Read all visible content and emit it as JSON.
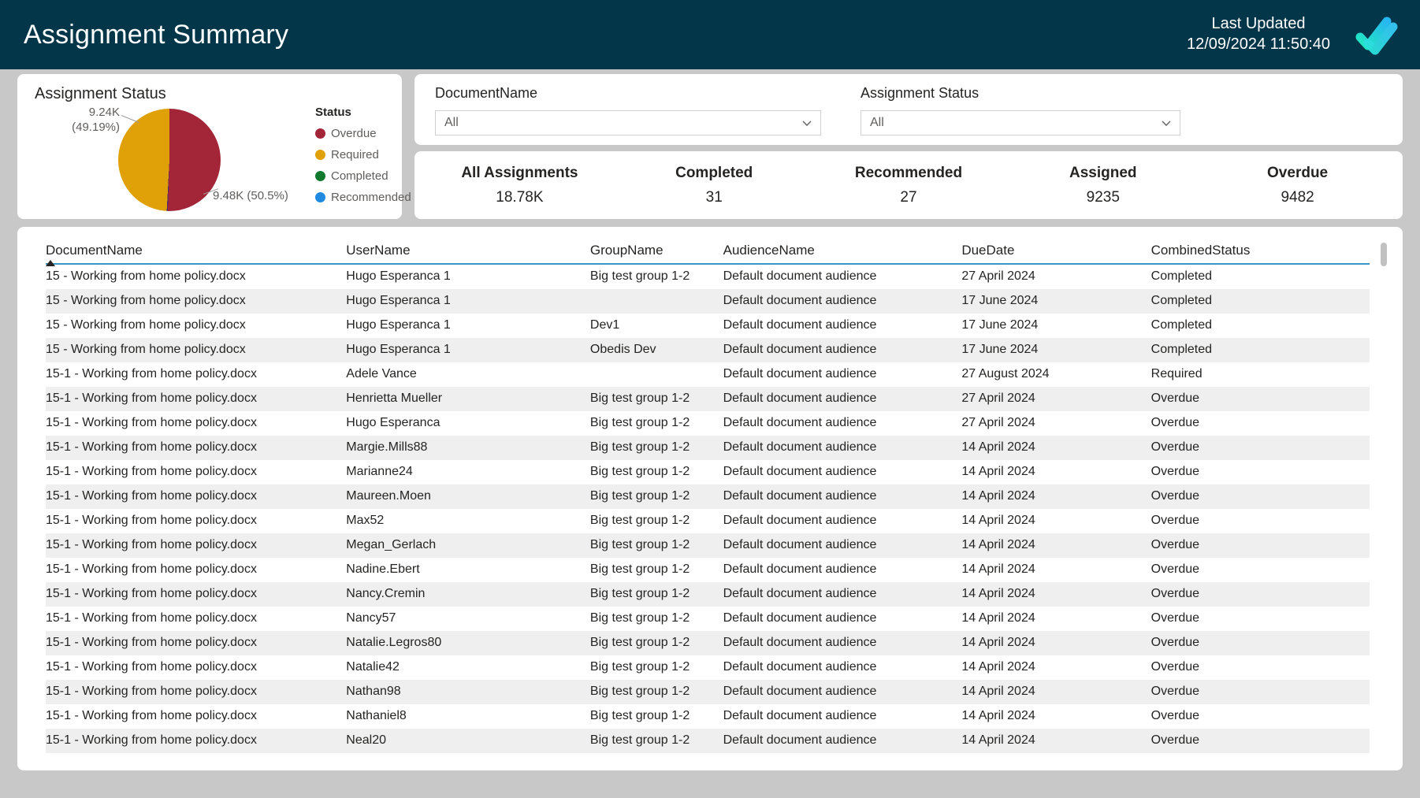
{
  "header": {
    "title": "Assignment Summary",
    "updated_label": "Last Updated",
    "updated_value": "12/09/2024 11:50:40",
    "logo_icon": "double-check-icon",
    "background_color": "#04364a"
  },
  "pie_card": {
    "title": "Assignment Status",
    "legend_title": "Status",
    "label_required": "9.24K\n(49.19%)",
    "label_required_line1": "9.24K",
    "label_required_line2": "(49.19%)",
    "label_overdue": "9.48K (50.5%)"
  },
  "chart_data": {
    "type": "pie",
    "title": "Assignment Status",
    "categories": [
      "Overdue",
      "Required",
      "Completed",
      "Recommended"
    ],
    "values": [
      9480,
      9240,
      31,
      27
    ],
    "value_labels": [
      "9.48K (50.5%)",
      "9.24K (49.19%)",
      "",
      ""
    ],
    "percents": [
      50.5,
      49.19,
      0.17,
      0.14
    ],
    "colors": [
      "#a32638",
      "#dfa008",
      "#117a2e",
      "#1f8ae0"
    ],
    "legend_title": "Status",
    "legend_position": "right",
    "grid": false
  },
  "slicers": [
    {
      "label": "DocumentName",
      "value": "All",
      "icon": "chevron-down-icon"
    },
    {
      "label": "Assignment Status",
      "value": "All",
      "icon": "chevron-down-icon"
    }
  ],
  "kpis": [
    {
      "title": "All Assignments",
      "value": "18.78K"
    },
    {
      "title": "Completed",
      "value": "31"
    },
    {
      "title": "Recommended",
      "value": "27"
    },
    {
      "title": "Assigned",
      "value": "9235"
    },
    {
      "title": "Overdue",
      "value": "9482"
    }
  ],
  "table": {
    "columns": [
      "DocumentName",
      "UserName",
      "GroupName",
      "AudienceName",
      "DueDate",
      "CombinedStatus"
    ],
    "sorted_column": "DocumentName",
    "sort_direction": "asc",
    "rows": [
      [
        "15 - Working from home policy.docx",
        "Hugo Esperanca 1",
        "Big test group 1-2",
        "Default document audience",
        "27 April 2024",
        "Completed"
      ],
      [
        "15 - Working from home policy.docx",
        "Hugo Esperanca 1",
        "",
        "Default document audience",
        "17 June 2024",
        "Completed"
      ],
      [
        "15 - Working from home policy.docx",
        "Hugo Esperanca 1",
        "Dev1",
        "Default document audience",
        "17 June 2024",
        "Completed"
      ],
      [
        "15 - Working from home policy.docx",
        "Hugo Esperanca 1",
        "Obedis Dev",
        "Default document audience",
        "17 June 2024",
        "Completed"
      ],
      [
        "15-1 - Working from home policy.docx",
        "Adele Vance",
        "",
        "Default document audience",
        "27 August 2024",
        "Required"
      ],
      [
        "15-1 - Working from home policy.docx",
        "Henrietta Mueller",
        "Big test group 1-2",
        "Default document audience",
        "27 April 2024",
        "Overdue"
      ],
      [
        "15-1 - Working from home policy.docx",
        "Hugo Esperanca",
        "Big test group 1-2",
        "Default document audience",
        "27 April 2024",
        "Overdue"
      ],
      [
        "15-1 - Working from home policy.docx",
        "Margie.Mills88",
        "Big test group 1-2",
        "Default document audience",
        "14 April 2024",
        "Overdue"
      ],
      [
        "15-1 - Working from home policy.docx",
        "Marianne24",
        "Big test group 1-2",
        "Default document audience",
        "14 April 2024",
        "Overdue"
      ],
      [
        "15-1 - Working from home policy.docx",
        "Maureen.Moen",
        "Big test group 1-2",
        "Default document audience",
        "14 April 2024",
        "Overdue"
      ],
      [
        "15-1 - Working from home policy.docx",
        "Max52",
        "Big test group 1-2",
        "Default document audience",
        "14 April 2024",
        "Overdue"
      ],
      [
        "15-1 - Working from home policy.docx",
        "Megan_Gerlach",
        "Big test group 1-2",
        "Default document audience",
        "14 April 2024",
        "Overdue"
      ],
      [
        "15-1 - Working from home policy.docx",
        "Nadine.Ebert",
        "Big test group 1-2",
        "Default document audience",
        "14 April 2024",
        "Overdue"
      ],
      [
        "15-1 - Working from home policy.docx",
        "Nancy.Cremin",
        "Big test group 1-2",
        "Default document audience",
        "14 April 2024",
        "Overdue"
      ],
      [
        "15-1 - Working from home policy.docx",
        "Nancy57",
        "Big test group 1-2",
        "Default document audience",
        "14 April 2024",
        "Overdue"
      ],
      [
        "15-1 - Working from home policy.docx",
        "Natalie.Legros80",
        "Big test group 1-2",
        "Default document audience",
        "14 April 2024",
        "Overdue"
      ],
      [
        "15-1 - Working from home policy.docx",
        "Natalie42",
        "Big test group 1-2",
        "Default document audience",
        "14 April 2024",
        "Overdue"
      ],
      [
        "15-1 - Working from home policy.docx",
        "Nathan98",
        "Big test group 1-2",
        "Default document audience",
        "14 April 2024",
        "Overdue"
      ],
      [
        "15-1 - Working from home policy.docx",
        "Nathaniel8",
        "Big test group 1-2",
        "Default document audience",
        "14 April 2024",
        "Overdue"
      ],
      [
        "15-1 - Working from home policy.docx",
        "Neal20",
        "Big test group 1-2",
        "Default document audience",
        "14 April 2024",
        "Overdue"
      ]
    ]
  }
}
